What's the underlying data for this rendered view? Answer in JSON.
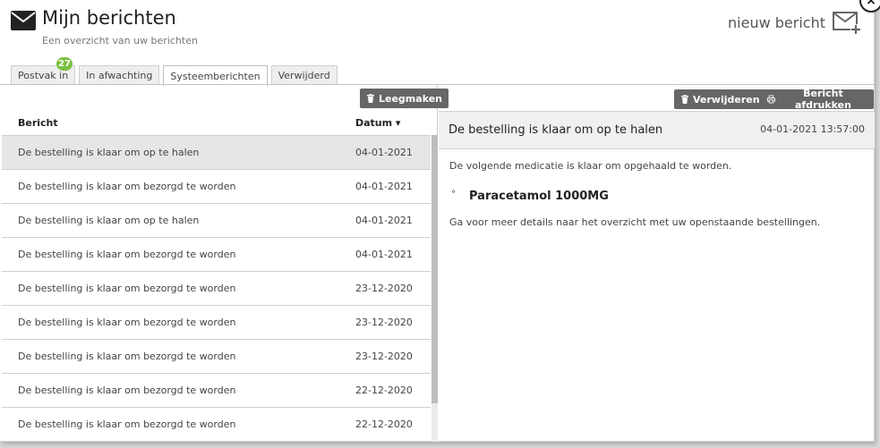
{
  "header": {
    "title": "Mijn berichten",
    "subtitle": "Een overzicht van uw berichten",
    "new_message_label": "nieuw bericht",
    "close_label": "×"
  },
  "tabs": [
    {
      "label": "Postvak in",
      "badge": "27"
    },
    {
      "label": "In afwachting"
    },
    {
      "label": "Systeemberichten",
      "active": true
    },
    {
      "label": "Verwijderd"
    }
  ],
  "list": {
    "clear_button": "Leegmaken",
    "col_subject": "Bericht",
    "col_date": "Datum ▾",
    "rows": [
      {
        "subject": "De bestelling is klaar om op te halen",
        "date": "04-01-2021",
        "selected": true
      },
      {
        "subject": "De bestelling is klaar om bezorgd te worden",
        "date": "04-01-2021"
      },
      {
        "subject": "De bestelling is klaar om op te halen",
        "date": "04-01-2021"
      },
      {
        "subject": "De bestelling is klaar om bezorgd te worden",
        "date": "04-01-2021"
      },
      {
        "subject": "De bestelling is klaar om bezorgd te worden",
        "date": "23-12-2020"
      },
      {
        "subject": "De bestelling is klaar om bezorgd te worden",
        "date": "23-12-2020"
      },
      {
        "subject": "De bestelling is klaar om bezorgd te worden",
        "date": "23-12-2020"
      },
      {
        "subject": "De bestelling is klaar om bezorgd te worden",
        "date": "22-12-2020"
      },
      {
        "subject": "De bestelling is klaar om bezorgd te worden",
        "date": "22-12-2020"
      }
    ]
  },
  "detail": {
    "delete_button": "Verwijderen",
    "print_button": "Bericht afdrukken",
    "subject": "De bestelling is klaar om op te halen",
    "datetime": "04-01-2021 13:57:00",
    "intro": "De volgende medicatie is klaar om opgehaald te worden.",
    "medication": "Paracetamol 1000MG",
    "note": "Ga voor meer details naar het overzicht met uw openstaande bestellingen."
  },
  "colors": {
    "badge": "#7cc142",
    "button": "#666666",
    "selected_row": "#e6e6e6"
  }
}
